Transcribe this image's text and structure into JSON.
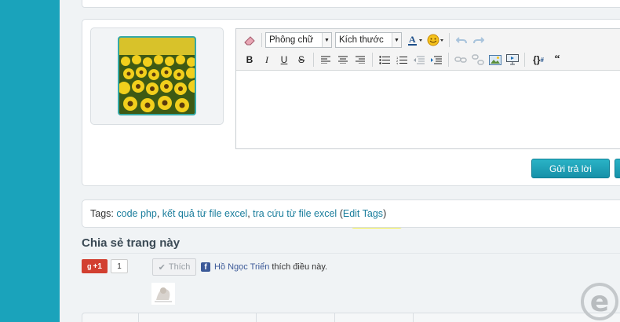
{
  "editor": {
    "font_select": "Phông chữ",
    "size_select": "Kích thước",
    "quote_glyph": "“"
  },
  "reply": {
    "submit_label": "Gửi trả lời"
  },
  "tags": {
    "prefix": "Tags:",
    "items": [
      "code php",
      "kết quả từ file excel",
      "tra cứu từ file excel"
    ],
    "edit_label": "Edit Tags",
    "highlight_color": "#f7f24a"
  },
  "share": {
    "title": "Chia sẻ trang này",
    "gplus_label": "+1",
    "gplus_count": "1",
    "like_label": "Thích",
    "like_name": "Hồ Ngọc Triển",
    "like_suffix": "thích điều này."
  },
  "colors": {
    "accent": "#1aa3bb",
    "link": "#1a7d9c",
    "button": "#1690a8"
  }
}
